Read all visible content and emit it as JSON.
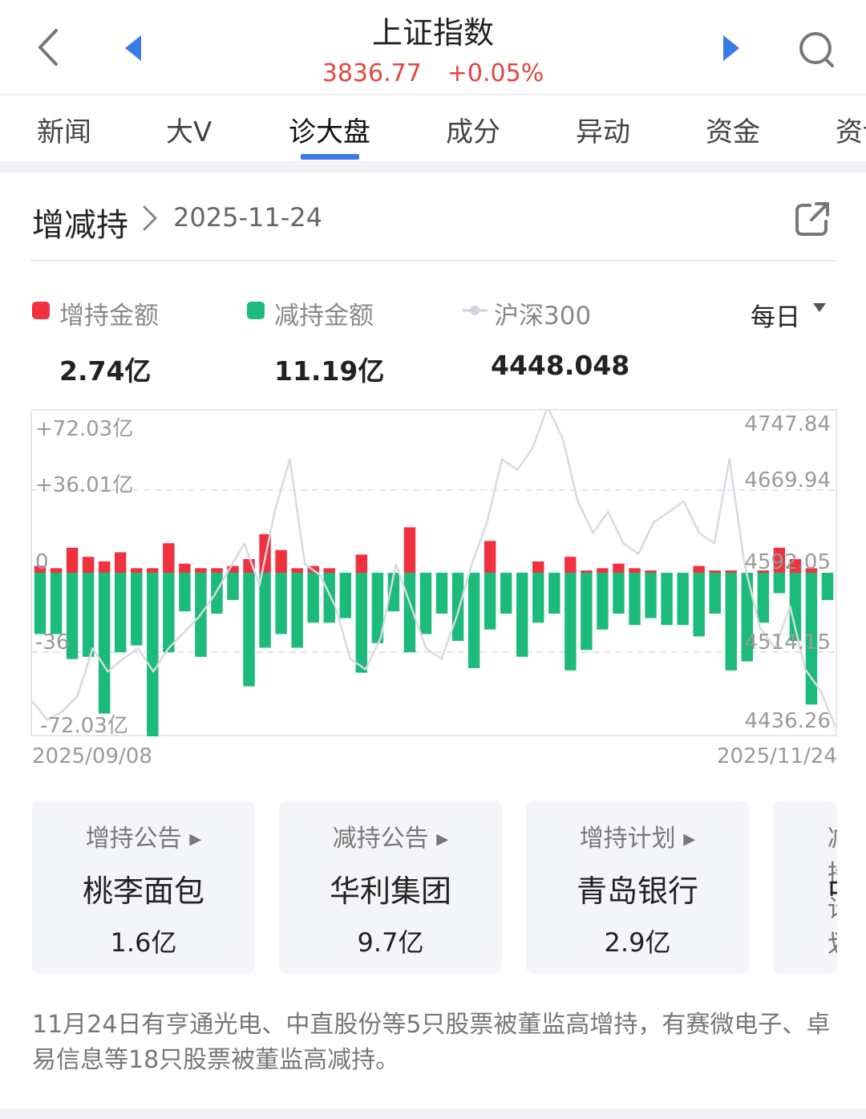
{
  "header": {
    "title": "上证指数",
    "price": "3836.77",
    "change": "+0.05%"
  },
  "tabs": [
    {
      "label": "新闻"
    },
    {
      "label": "大V"
    },
    {
      "label": "诊大盘",
      "active": true
    },
    {
      "label": "成分"
    },
    {
      "label": "异动"
    },
    {
      "label": "资金"
    },
    {
      "label": "资讯"
    }
  ],
  "card": {
    "title": "增减持",
    "date": "2025-11-24"
  },
  "legend": {
    "increase": {
      "label": "增持金额",
      "value": "2.74亿",
      "color": "#f0313f"
    },
    "decrease": {
      "label": "减持金额",
      "value": "11.19亿",
      "color": "#1dbb7b"
    },
    "index": {
      "label": "沪深300",
      "value": "4448.048",
      "color": "#d0d4db"
    },
    "period": "每日"
  },
  "chart_data": {
    "type": "bar",
    "left_axis_labels": [
      "+72.03亿",
      "+36.01亿",
      "0",
      "-36",
      "-72.03亿"
    ],
    "right_axis_labels": [
      "4747.84",
      "4669.94",
      "4592.05",
      "4514.15",
      "4436.26"
    ],
    "ylim_left": [
      -72.03,
      72.03
    ],
    "ylim_right": [
      4436.26,
      4747.84
    ],
    "x_start": "2025/09/08",
    "x_end": "2025/11/24",
    "grid": "dashed",
    "series": [
      {
        "name": "增持金额",
        "color": "#f0313f",
        "values": [
          3,
          2,
          11,
          7,
          5,
          9,
          2,
          2,
          13,
          4,
          2,
          2,
          3,
          6,
          17,
          10,
          2,
          3,
          2,
          0,
          8,
          0,
          0,
          20,
          0,
          0,
          0,
          0,
          14,
          0,
          0,
          5,
          0,
          7,
          1,
          2,
          4,
          2,
          1,
          0,
          0,
          3,
          1,
          1,
          0,
          1,
          11,
          6,
          2,
          0
        ]
      },
      {
        "name": "减持金额",
        "color": "#1dbb7b",
        "values": [
          -27,
          -27,
          -38,
          -37,
          -62,
          -35,
          -32,
          -73,
          -35,
          -17,
          -37,
          -18,
          -12,
          -50,
          -33,
          -27,
          -33,
          -22,
          -22,
          -20,
          -44,
          -31,
          -17,
          -35,
          -27,
          -18,
          -30,
          -42,
          -25,
          -18,
          -37,
          -22,
          -18,
          -43,
          -34,
          -25,
          -18,
          -23,
          -20,
          -23,
          -23,
          -28,
          -18,
          -43,
          -39,
          -22,
          -9,
          -30,
          -58,
          -12
        ]
      },
      {
        "name": "沪深300",
        "color": "#d7dae0",
        "values": [
          4470,
          4452,
          4460,
          4475,
          4520,
          4498,
          4510,
          4520,
          4498,
          4520,
          4535,
          4550,
          4570,
          4595,
          4620,
          4580,
          4650,
          4700,
          4600,
          4590,
          4560,
          4510,
          4500,
          4530,
          4600,
          4560,
          4520,
          4510,
          4550,
          4600,
          4640,
          4700,
          4690,
          4710,
          4750,
          4720,
          4660,
          4630,
          4650,
          4620,
          4610,
          4640,
          4650,
          4660,
          4630,
          4620,
          4700,
          4600,
          4540,
          4520,
          4560,
          4500,
          4480,
          4445
        ]
      }
    ]
  },
  "bottom_cards": [
    {
      "label": "增持公告",
      "name": "桃李面包",
      "value": "1.6亿"
    },
    {
      "label": "减持公告",
      "name": "华利集团",
      "value": "9.7亿"
    },
    {
      "label": "增持计划",
      "name": "青岛银行",
      "value": "2.9亿"
    },
    {
      "label": "减持计划",
      "name": "中",
      "value": ""
    }
  ],
  "summary": "11月24日有亨通光电、中直股份等5只股票被董监高增持，有赛微电子、卓易信息等18只股票被董监高减持。"
}
